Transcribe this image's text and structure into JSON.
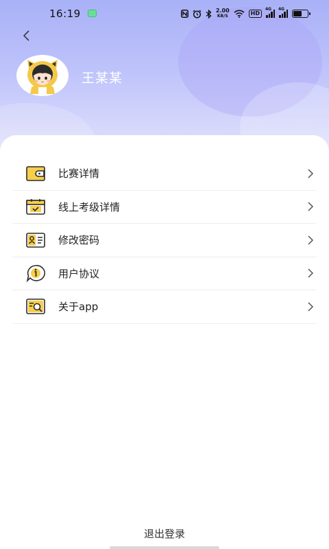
{
  "status_bar": {
    "time": "16:19",
    "net_speed_value": "2.00",
    "net_speed_unit": "KB/S",
    "hd_badge": "HD",
    "signal1_label": "4G",
    "signal2_label": "4G",
    "battery_level": 0.6,
    "icons": [
      "nfc-icon",
      "alarm-icon",
      "bluetooth-icon",
      "wifi-icon"
    ]
  },
  "header": {
    "back_icon": "chevron-left-icon",
    "user_name": "王某某",
    "avatar": "cartoon-avatar"
  },
  "menu": {
    "items": [
      {
        "label": "比赛详情",
        "icon": "wallet-icon"
      },
      {
        "label": "线上考级详情",
        "icon": "calendar-check-icon"
      },
      {
        "label": "修改密码",
        "icon": "id-card-icon"
      },
      {
        "label": "用户协议",
        "icon": "info-chat-icon"
      },
      {
        "label": "关于app",
        "icon": "search-document-icon"
      }
    ]
  },
  "footer": {
    "logout_label": "退出登录"
  },
  "colors": {
    "header_gradient_top": "#a9b1f7",
    "icon_yellow": "#f7cf4a",
    "icon_stroke": "#2b2b2b"
  }
}
